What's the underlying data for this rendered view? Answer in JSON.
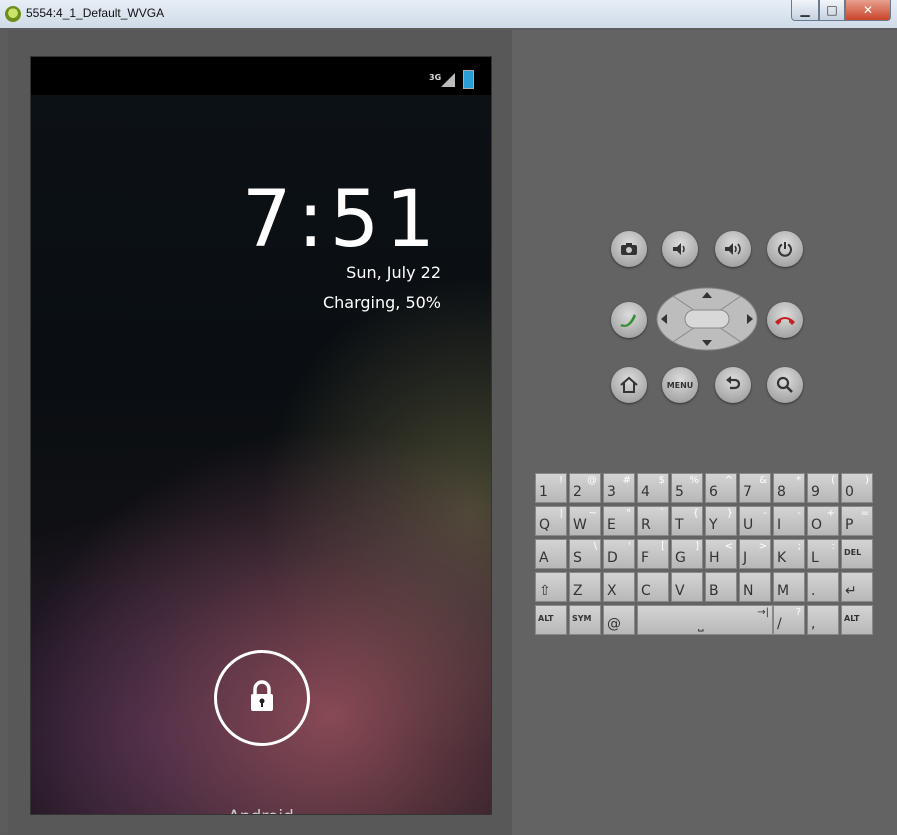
{
  "window": {
    "title": "5554:4_1_Default_WVGA"
  },
  "statusbar": {
    "network": "3G"
  },
  "lockscreen": {
    "time": "7:51",
    "date": "Sun, July 22",
    "battery_status": "Charging, 50%",
    "owner": "Android",
    "lock_icon": "lock-icon"
  },
  "hardware": {
    "menu_label": "MENU"
  },
  "keyboard": {
    "rows": [
      [
        {
          "m": "1",
          "a": "!"
        },
        {
          "m": "2",
          "a": "@"
        },
        {
          "m": "3",
          "a": "#"
        },
        {
          "m": "4",
          "a": "$"
        },
        {
          "m": "5",
          "a": "%"
        },
        {
          "m": "6",
          "a": "^"
        },
        {
          "m": "7",
          "a": "&"
        },
        {
          "m": "8",
          "a": "*"
        },
        {
          "m": "9",
          "a": "("
        },
        {
          "m": "0",
          "a": ")"
        }
      ],
      [
        {
          "m": "Q",
          "a": "|"
        },
        {
          "m": "W",
          "a": "~"
        },
        {
          "m": "E",
          "a": "\""
        },
        {
          "m": "R",
          "a": "`"
        },
        {
          "m": "T",
          "a": "{"
        },
        {
          "m": "Y",
          "a": "}"
        },
        {
          "m": "U",
          "a": "-"
        },
        {
          "m": "I",
          "a": "-"
        },
        {
          "m": "O",
          "a": "+"
        },
        {
          "m": "P",
          "a": "="
        }
      ],
      [
        {
          "m": "A",
          "a": ""
        },
        {
          "m": "S",
          "a": "\\"
        },
        {
          "m": "D",
          "a": "'"
        },
        {
          "m": "F",
          "a": "["
        },
        {
          "m": "G",
          "a": "]"
        },
        {
          "m": "H",
          "a": "<"
        },
        {
          "m": "J",
          "a": ">"
        },
        {
          "m": "K",
          "a": ";"
        },
        {
          "m": "L",
          "a": ":"
        },
        {
          "m": "DEL",
          "a": ""
        }
      ],
      [
        {
          "m": "⇧",
          "a": ""
        },
        {
          "m": "Z",
          "a": ""
        },
        {
          "m": "X",
          "a": ""
        },
        {
          "m": "C",
          "a": ""
        },
        {
          "m": "V",
          "a": ""
        },
        {
          "m": "B",
          "a": ""
        },
        {
          "m": "N",
          "a": ""
        },
        {
          "m": "M",
          "a": ""
        },
        {
          "m": ".",
          "a": ""
        },
        {
          "m": "↵",
          "a": ""
        }
      ]
    ],
    "bottom": {
      "alt_left": "ALT",
      "sym": "SYM",
      "at": "@",
      "space": "⎵",
      "tab": "→|",
      "slash": "/",
      "question": "?",
      "comma": ",",
      "alt_right": "ALT"
    }
  }
}
